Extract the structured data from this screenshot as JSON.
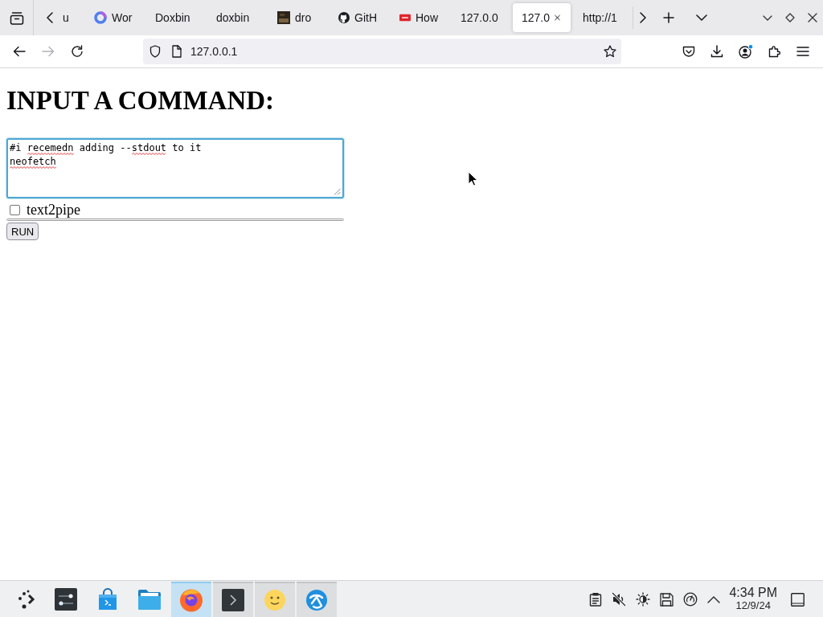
{
  "tab_bar": {
    "tabs": [
      {
        "label": "u",
        "selected": false
      },
      {
        "label": "Wor",
        "selected": false
      },
      {
        "label": "Doxbin",
        "selected": false
      },
      {
        "label": "doxbin",
        "selected": false
      },
      {
        "label": "dro",
        "selected": false
      },
      {
        "label": "GitH",
        "selected": false
      },
      {
        "label": "How",
        "selected": false
      },
      {
        "label": "127.0.0",
        "selected": false
      },
      {
        "label": "127.0",
        "selected": true
      },
      {
        "label": "http://1",
        "selected": false
      }
    ]
  },
  "toolbar": {
    "back_button": {
      "disabled": false
    },
    "forward_button": {
      "disabled": true
    },
    "address": "127.0.0.1",
    "bookmarked": false,
    "account_notification": true
  },
  "page": {
    "heading": "INPUT A COMMAND:",
    "command_box": {
      "focused": true,
      "lines": [
        {
          "segments": [
            {
              "text": "#i ",
              "misspelled": false
            },
            {
              "text": "recemedn",
              "misspelled": true
            },
            {
              "text": " adding --",
              "misspelled": false
            },
            {
              "text": "stdout",
              "misspelled": true
            },
            {
              "text": " to it",
              "misspelled": false
            }
          ]
        },
        {
          "segments": [
            {
              "text": "neofetch",
              "misspelled": true
            }
          ]
        }
      ]
    },
    "text2pipe": {
      "label": "text2pipe",
      "checked": false
    },
    "run_button": "RUN"
  },
  "taskbar": {
    "tasks": [
      {
        "open": false,
        "selected": false
      },
      {
        "open": false,
        "selected": false
      },
      {
        "open": false,
        "selected": false
      },
      {
        "open": true,
        "selected": true
      },
      {
        "open": true,
        "selected": false
      },
      {
        "open": true,
        "selected": false
      },
      {
        "open": true,
        "selected": false
      }
    ],
    "clock": {
      "time": "4:34 PM",
      "date": "12/9/24"
    }
  }
}
